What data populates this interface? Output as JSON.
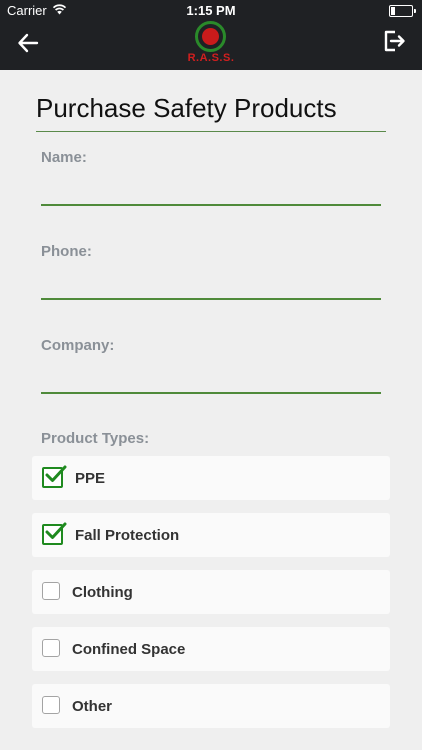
{
  "status_bar": {
    "carrier": "Carrier",
    "time": "1:15 PM",
    "battery_level": 0.15
  },
  "nav": {
    "logo_text": "R.A.S.S.",
    "back_icon": "arrow-left-icon",
    "exit_icon": "logout-icon"
  },
  "page": {
    "title": "Purchase Safety Products"
  },
  "form": {
    "name": {
      "label": "Name:",
      "value": ""
    },
    "phone": {
      "label": "Phone:",
      "value": ""
    },
    "company": {
      "label": "Company:",
      "value": ""
    }
  },
  "product_types": {
    "label": "Product Types:",
    "items": [
      {
        "label": "PPE",
        "checked": true
      },
      {
        "label": "Fall Protection",
        "checked": true
      },
      {
        "label": "Clothing",
        "checked": false
      },
      {
        "label": "Confined Space",
        "checked": false
      },
      {
        "label": "Other",
        "checked": false
      }
    ]
  },
  "colors": {
    "topbar": "#1f2124",
    "accent_green": "#1f8a1f",
    "underline": "#4f8a3a",
    "logo_red": "#d21f1f"
  }
}
